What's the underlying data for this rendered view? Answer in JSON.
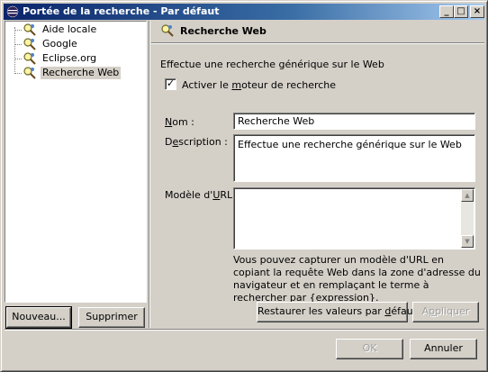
{
  "window": {
    "title": "Portée de la recherche - Par défaut",
    "controls": {
      "minimize": "_",
      "maximize": "□",
      "close": "×"
    }
  },
  "tree": {
    "items": [
      {
        "label": "Aide locale",
        "icon": "search-engine-icon",
        "selected": false
      },
      {
        "label": "Google",
        "icon": "search-engine-icon",
        "selected": false
      },
      {
        "label": "Eclipse.org",
        "icon": "search-engine-icon",
        "selected": false
      },
      {
        "label": "Recherche Web",
        "icon": "search-engine-icon",
        "selected": true
      }
    ],
    "new_button": "Nouveau...",
    "delete_button": "Supprimer"
  },
  "detail": {
    "header_title": "Recherche Web",
    "description_text": "Effectue une recherche générique sur le Web",
    "enable_checkbox": {
      "checked": true,
      "label_pre": "Activer le ",
      "label_u": "m",
      "label_post": "oteur de recherche"
    },
    "name_label_u": "N",
    "name_label_rest": "om :",
    "name_value": "Recherche Web",
    "desc_label_pre": "D",
    "desc_label_u": "e",
    "desc_label_post": "scription :",
    "desc_value": "Effectue une recherche générique sur le Web",
    "url_label_pre": "Modèle d'",
    "url_label_u": "U",
    "url_label_post": "RL :",
    "url_value": "",
    "help_text": "Vous pouvez capturer un modèle d'URL en copiant la requête Web dans la zone d'adresse du navigateur et en remplaçant le terme à rechercher par {expression}.",
    "restore_pre": "Restaurer les valeurs par ",
    "restore_u": "d",
    "restore_post": "éfaut",
    "apply_pre": "A",
    "apply_u": "p",
    "apply_post": "pliquer"
  },
  "footer": {
    "ok_button": "OK",
    "cancel_button": "Annuler"
  },
  "colors": {
    "title_gradient_start": "#0a246a",
    "title_gradient_end": "#a6caf0",
    "dialog_bg": "#d4d0c8"
  }
}
